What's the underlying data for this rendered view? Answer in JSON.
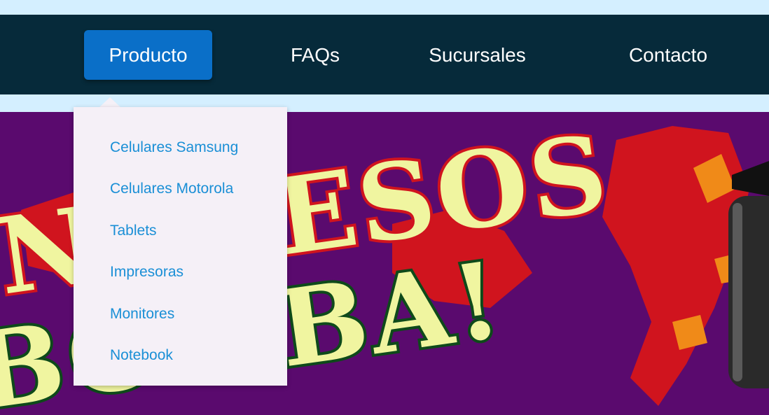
{
  "nav": {
    "items": [
      {
        "label": "Producto",
        "active": true
      },
      {
        "label": "FAQs"
      },
      {
        "label": "Sucursales"
      },
      {
        "label": "Contacto"
      }
    ]
  },
  "dropdown": {
    "items": [
      {
        "label": "Celulares Samsung"
      },
      {
        "label": "Celulares Motorola"
      },
      {
        "label": "Tablets"
      },
      {
        "label": "Impresoras"
      },
      {
        "label": "Monitores"
      },
      {
        "label": "Notebook"
      }
    ]
  },
  "banner": {
    "line1": "INGRESOS",
    "line2": "BOMBA!"
  },
  "colors": {
    "nav_bg": "#062a3a",
    "active_bg": "#0a6fc8",
    "banner_bg": "#5a0a6e",
    "banner_text": "#f0f5a0",
    "banner_shadow_red": "#d0141e",
    "dropdown_link": "#1a8fd6"
  }
}
